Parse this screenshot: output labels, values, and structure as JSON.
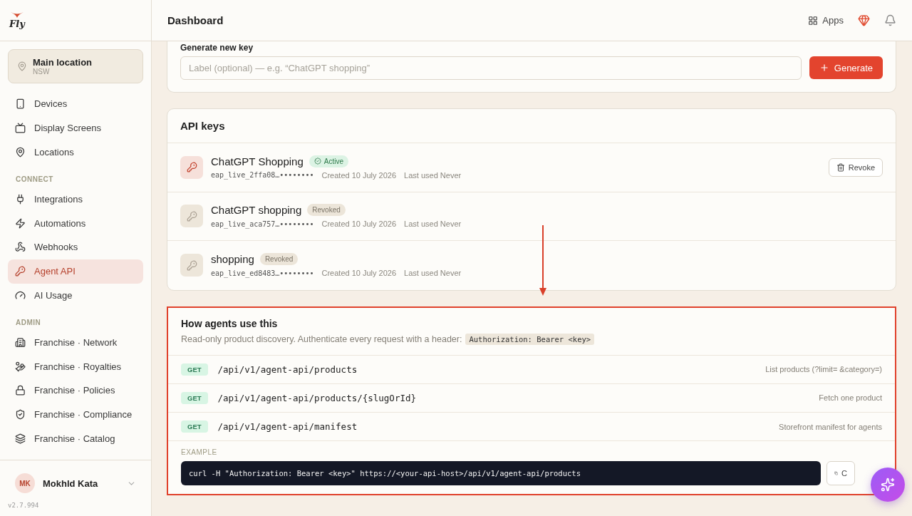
{
  "brand": {
    "logo_text": "Fly"
  },
  "location": {
    "name": "Main location",
    "region": "NSW"
  },
  "nav_sections": [
    {
      "items": [
        {
          "label": "Devices",
          "selected": false
        },
        {
          "label": "Display Screens",
          "selected": false
        },
        {
          "label": "Locations",
          "selected": false
        }
      ]
    },
    {
      "heading": "CONNECT",
      "items": [
        {
          "label": "Integrations",
          "selected": false
        },
        {
          "label": "Automations",
          "selected": false
        },
        {
          "label": "Webhooks",
          "selected": false
        },
        {
          "label": "Agent API",
          "selected": true
        },
        {
          "label": "AI Usage",
          "selected": false
        }
      ]
    },
    {
      "heading": "ADMIN",
      "items": [
        {
          "label": "Franchise · Network",
          "selected": false
        },
        {
          "label": "Franchise · Royalties",
          "selected": false
        },
        {
          "label": "Franchise · Policies",
          "selected": false
        },
        {
          "label": "Franchise · Compliance",
          "selected": false
        },
        {
          "label": "Franchise · Catalog",
          "selected": false
        }
      ]
    }
  ],
  "user": {
    "initials": "MK",
    "name": "Mokhld Kata"
  },
  "version": "v2.7.994",
  "header": {
    "title": "Dashboard",
    "apps_label": "Apps"
  },
  "generate": {
    "label": "Generate new key",
    "placeholder": "Label (optional) — e.g. “ChatGPT shopping”",
    "button": "Generate"
  },
  "api_keys": {
    "title": "API keys",
    "keys": [
      {
        "name": "ChatGPT Shopping",
        "kind": "active",
        "badge": "Active",
        "key": "eap_live_2ffa08…••••••••",
        "created": "Created 10 July 2026",
        "last_used": "Last used Never",
        "action": "Revoke"
      },
      {
        "name": "ChatGPT shopping",
        "kind": "revoked",
        "badge": "Revoked",
        "key": "eap_live_aca757…••••••••",
        "created": "Created 10 July 2026",
        "last_used": "Last used Never"
      },
      {
        "name": "shopping",
        "kind": "revoked",
        "badge": "Revoked",
        "key": "eap_live_ed8483…••••••••",
        "created": "Created 10 July 2026",
        "last_used": "Last used Never"
      }
    ]
  },
  "usage": {
    "title": "How agents use this",
    "intro": "Read-only product discovery. Authenticate every request with a header:",
    "header_code": "Authorization: Bearer <key>",
    "endpoints": [
      {
        "method": "GET",
        "path": "/api/v1/agent-api/products",
        "description": "List products (?limit= &category=)"
      },
      {
        "method": "GET",
        "path": "/api/v1/agent-api/products/{slugOrId}",
        "description": "Fetch one product"
      },
      {
        "method": "GET",
        "path": "/api/v1/agent-api/manifest",
        "description": "Storefront manifest for agents"
      }
    ],
    "example_label": "EXAMPLE",
    "example": "curl -H \"Authorization: Bearer <key>\" https://<your-api-host>/api/v1/agent-api/products",
    "copy_label": "C"
  }
}
